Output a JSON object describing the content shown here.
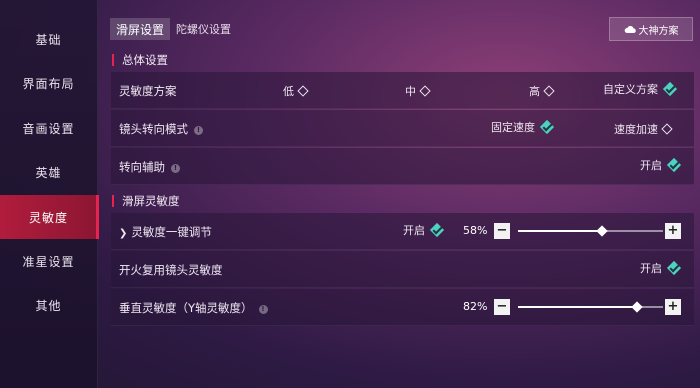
{
  "sidebar": {
    "items": [
      {
        "label": "基础",
        "active": false
      },
      {
        "label": "界面布局",
        "active": false
      },
      {
        "label": "音画设置",
        "active": false
      },
      {
        "label": "英雄",
        "active": false
      },
      {
        "label": "灵敏度",
        "active": true
      },
      {
        "label": "准星设置",
        "active": false
      },
      {
        "label": "其他",
        "active": false
      }
    ]
  },
  "tabs": [
    {
      "label": "滑屏设置",
      "active": true
    },
    {
      "label": "陀螺仪设置",
      "active": false
    }
  ],
  "special_button": {
    "label": "大神方案",
    "icon": "cloud-icon"
  },
  "sections": {
    "general": {
      "title": "总体设置"
    },
    "slide": {
      "title": "滑屏灵敏度"
    }
  },
  "rows": {
    "sensitivity_plan": {
      "label": "灵敏度方案",
      "options": [
        {
          "label": "低",
          "selected": false
        },
        {
          "label": "中",
          "selected": false
        },
        {
          "label": "高",
          "selected": false
        },
        {
          "label": "自定义方案",
          "selected": true
        }
      ]
    },
    "camera_mode": {
      "label": "镜头转向模式",
      "options": [
        {
          "label": "固定速度",
          "selected": true
        },
        {
          "label": "速度加速",
          "selected": false
        }
      ]
    },
    "turn_assist": {
      "label": "转向辅助",
      "toggle_label": "开启",
      "enabled": true
    },
    "one_key": {
      "label": "灵敏度一键调节",
      "toggle_label": "开启",
      "enabled": true,
      "percent": "58%",
      "value": 0.58
    },
    "fire_reuse": {
      "label": "开火复用镜头灵敏度",
      "toggle_label": "开启",
      "enabled": true
    },
    "vertical": {
      "label": "垂直灵敏度（Y轴灵敏度）",
      "percent": "82%",
      "value": 0.82
    }
  },
  "colors": {
    "accent_red": "#b11c3d",
    "check_teal": "#4fd0c4"
  }
}
